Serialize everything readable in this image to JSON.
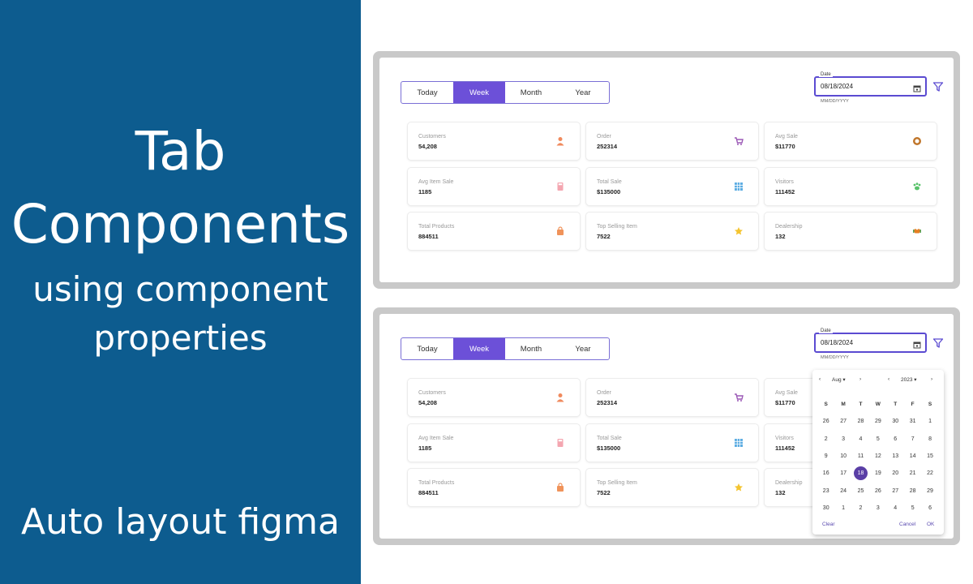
{
  "left_panel": {
    "title_line1": "Tab",
    "title_line2": "Components",
    "subtitle_line1": "using component",
    "subtitle_line2": "properties",
    "footer": "Auto layout figma",
    "bg_color": "#0d5c8f"
  },
  "tabs": [
    "Today",
    "Week",
    "Month",
    "Year"
  ],
  "active_tab": "Week",
  "date": {
    "label": "Date",
    "value": "08/18/2024",
    "hint": "MM/DD/YYYY"
  },
  "cards": [
    {
      "label": "Customers",
      "value": "54,208",
      "icon": "person-icon",
      "color": "#f08a5d"
    },
    {
      "label": "Order",
      "value": "252314",
      "icon": "cart-icon",
      "color": "#9b59b6"
    },
    {
      "label": "Avg Sale",
      "value": "$11770",
      "icon": "coin-icon",
      "color": "#c0762b"
    },
    {
      "label": "Avg Item Sale",
      "value": "1185",
      "icon": "calculator-icon",
      "color": "#f4a6b0"
    },
    {
      "label": "Total Sale",
      "value": "$135000",
      "icon": "grid-icon",
      "color": "#5dade2"
    },
    {
      "label": "Visitors",
      "value": "111452",
      "icon": "paw-icon",
      "color": "#58c26a"
    },
    {
      "label": "Total Products",
      "value": "884511",
      "icon": "bag-icon",
      "color": "#f0935a"
    },
    {
      "label": "Top Selling Item",
      "value": "7522",
      "icon": "star-icon",
      "color": "#f4c430"
    },
    {
      "label": "Dealership",
      "value": "132",
      "icon": "handshake-icon",
      "color": "#e67e22"
    }
  ],
  "datepicker": {
    "month": "Aug",
    "year": "2023",
    "weekdays": [
      "S",
      "M",
      "T",
      "W",
      "T",
      "F",
      "S"
    ],
    "weeks": [
      [
        "26",
        "27",
        "28",
        "29",
        "30",
        "31",
        "1"
      ],
      [
        "2",
        "3",
        "4",
        "5",
        "6",
        "7",
        "8"
      ],
      [
        "9",
        "10",
        "11",
        "12",
        "13",
        "14",
        "15"
      ],
      [
        "16",
        "17",
        "18",
        "19",
        "20",
        "21",
        "22"
      ],
      [
        "23",
        "24",
        "25",
        "26",
        "27",
        "28",
        "29"
      ],
      [
        "30",
        "1",
        "2",
        "3",
        "4",
        "5",
        "6"
      ]
    ],
    "selected_day": "18",
    "clear": "Clear",
    "cancel": "Cancel",
    "ok": "OK"
  },
  "accent_color": "#6c50d8"
}
